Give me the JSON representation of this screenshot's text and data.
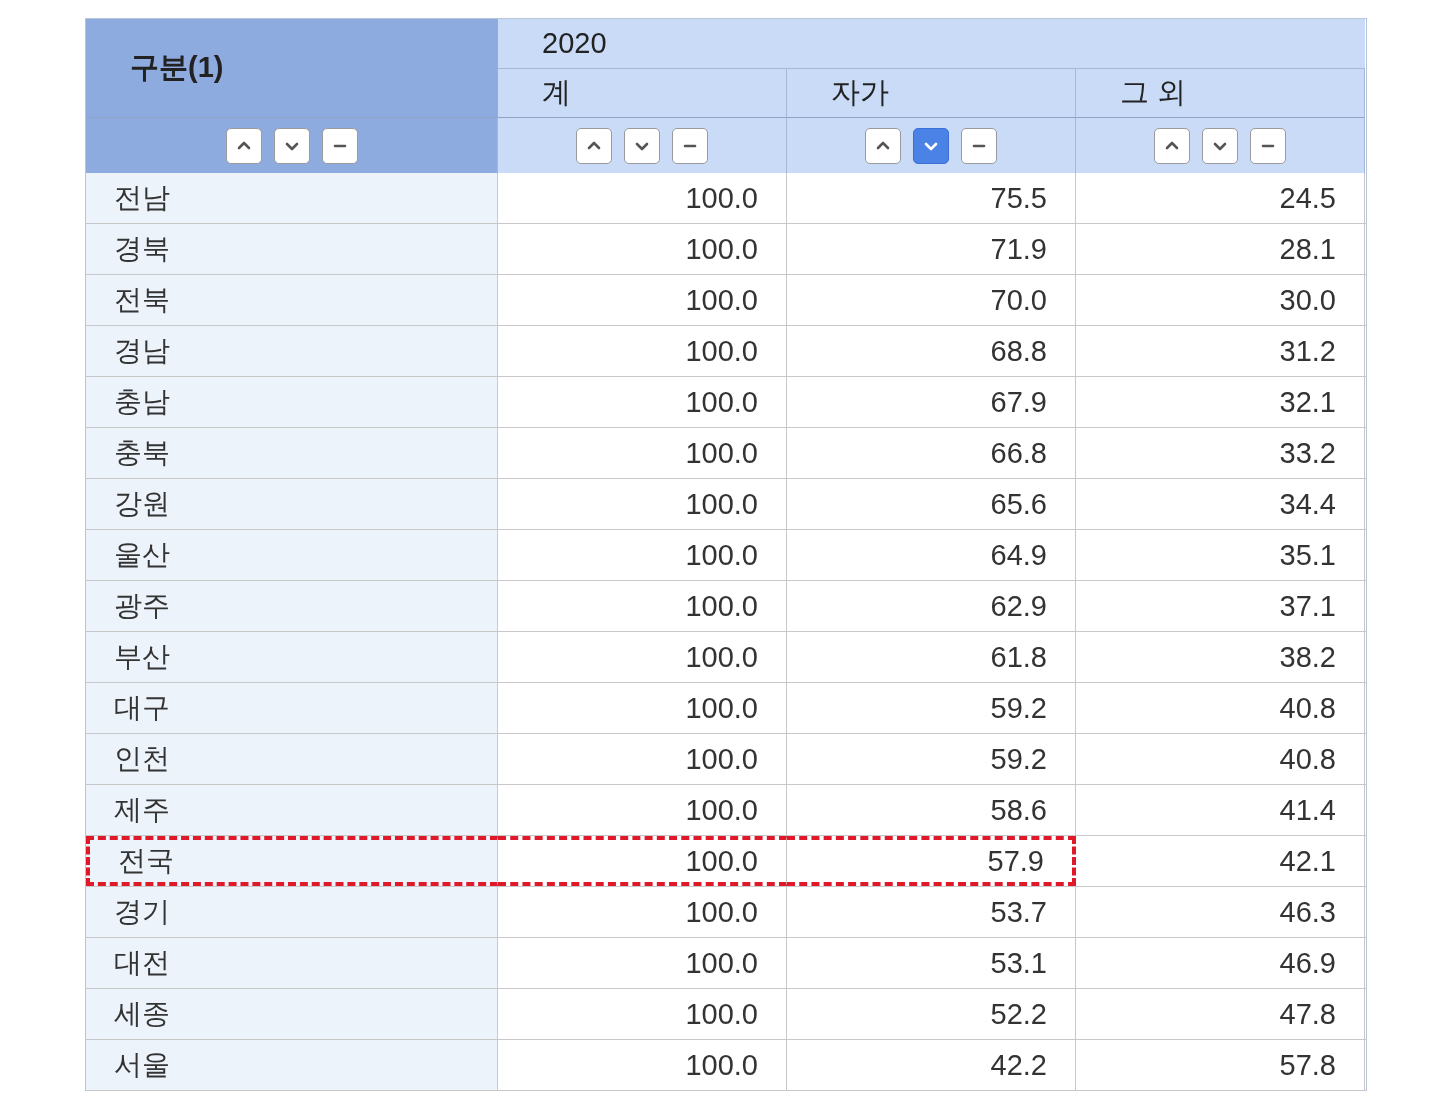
{
  "header": {
    "stub": "구분(1)",
    "year": "2020",
    "columns": [
      "계",
      "자가",
      "그 외"
    ]
  },
  "sort_controls": [
    [
      {
        "kind": "up",
        "selected": false
      },
      {
        "kind": "down",
        "selected": false
      },
      {
        "kind": "none",
        "selected": false
      }
    ],
    [
      {
        "kind": "up",
        "selected": false
      },
      {
        "kind": "down",
        "selected": false
      },
      {
        "kind": "none",
        "selected": false
      }
    ],
    [
      {
        "kind": "up",
        "selected": false
      },
      {
        "kind": "down",
        "selected": true
      },
      {
        "kind": "none",
        "selected": false
      }
    ],
    [
      {
        "kind": "up",
        "selected": false
      },
      {
        "kind": "down",
        "selected": false
      },
      {
        "kind": "none",
        "selected": false
      }
    ]
  ],
  "rows": [
    {
      "region": "전남",
      "values": [
        "100.0",
        "75.5",
        "24.5"
      ],
      "highlighted": false
    },
    {
      "region": "경북",
      "values": [
        "100.0",
        "71.9",
        "28.1"
      ],
      "highlighted": false
    },
    {
      "region": "전북",
      "values": [
        "100.0",
        "70.0",
        "30.0"
      ],
      "highlighted": false
    },
    {
      "region": "경남",
      "values": [
        "100.0",
        "68.8",
        "31.2"
      ],
      "highlighted": false
    },
    {
      "region": "충남",
      "values": [
        "100.0",
        "67.9",
        "32.1"
      ],
      "highlighted": false
    },
    {
      "region": "충북",
      "values": [
        "100.0",
        "66.8",
        "33.2"
      ],
      "highlighted": false
    },
    {
      "region": "강원",
      "values": [
        "100.0",
        "65.6",
        "34.4"
      ],
      "highlighted": false
    },
    {
      "region": "울산",
      "values": [
        "100.0",
        "64.9",
        "35.1"
      ],
      "highlighted": false
    },
    {
      "region": "광주",
      "values": [
        "100.0",
        "62.9",
        "37.1"
      ],
      "highlighted": false
    },
    {
      "region": "부산",
      "values": [
        "100.0",
        "61.8",
        "38.2"
      ],
      "highlighted": false
    },
    {
      "region": "대구",
      "values": [
        "100.0",
        "59.2",
        "40.8"
      ],
      "highlighted": false
    },
    {
      "region": "인천",
      "values": [
        "100.0",
        "59.2",
        "40.8"
      ],
      "highlighted": false
    },
    {
      "region": "제주",
      "values": [
        "100.0",
        "58.6",
        "41.4"
      ],
      "highlighted": false
    },
    {
      "region": "전국",
      "values": [
        "100.0",
        "57.9",
        "42.1"
      ],
      "highlighted": true
    },
    {
      "region": "경기",
      "values": [
        "100.0",
        "53.7",
        "46.3"
      ],
      "highlighted": false
    },
    {
      "region": "대전",
      "values": [
        "100.0",
        "53.1",
        "46.9"
      ],
      "highlighted": false
    },
    {
      "region": "세종",
      "values": [
        "100.0",
        "52.2",
        "47.8"
      ],
      "highlighted": false
    },
    {
      "region": "서울",
      "values": [
        "100.0",
        "42.2",
        "57.8"
      ],
      "highlighted": false
    }
  ]
}
